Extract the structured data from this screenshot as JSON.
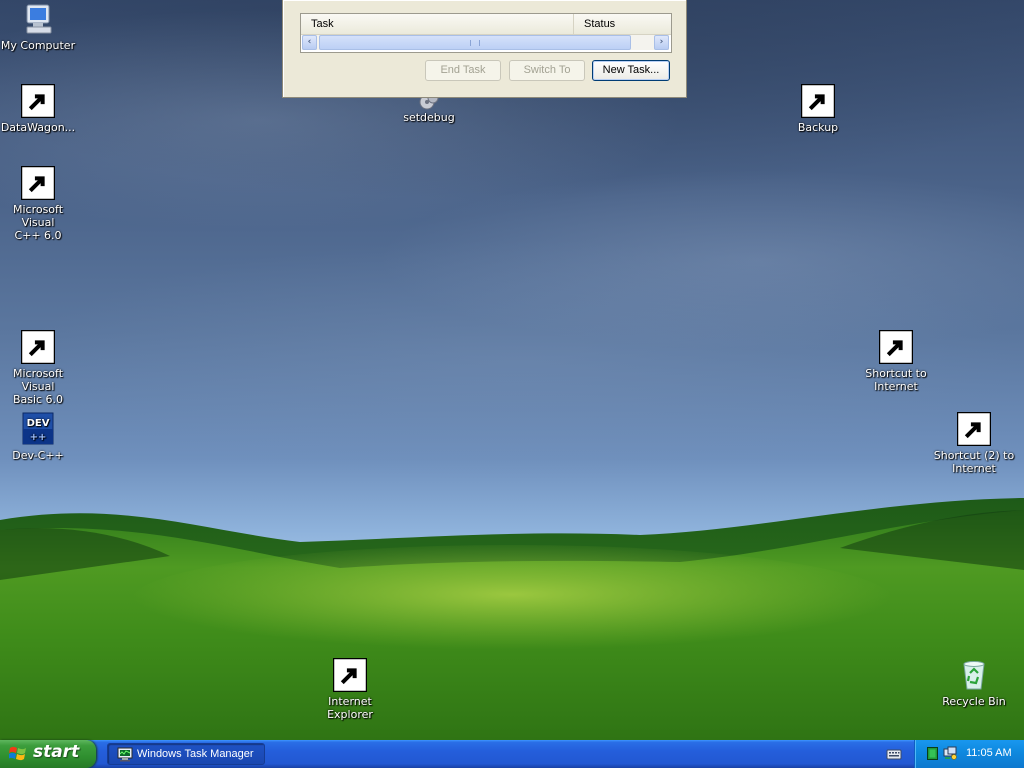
{
  "desktop": {
    "icons": [
      {
        "id": "my-computer",
        "label": "My Computer"
      },
      {
        "id": "datawagon",
        "label": "DataWagon..."
      },
      {
        "id": "setdebug",
        "label": "setdebug"
      },
      {
        "id": "backup",
        "label": "Backup"
      },
      {
        "id": "msvc",
        "label": "Microsoft Visual\nC++ 6.0"
      },
      {
        "id": "msvb",
        "label": "Microsoft Visual\nBasic 6.0"
      },
      {
        "id": "devcpp",
        "label": "Dev-C++"
      },
      {
        "id": "shortcut-internet",
        "label": "Shortcut to\nInternet"
      },
      {
        "id": "shortcut2-internet",
        "label": "Shortcut (2) to\nInternet"
      },
      {
        "id": "internet-explorer",
        "label": "Internet\nExplorer"
      },
      {
        "id": "recycle-bin",
        "label": "Recycle Bin"
      }
    ]
  },
  "task_manager": {
    "columns": {
      "task": "Task",
      "status": "Status"
    },
    "buttons": {
      "end_task": "End Task",
      "switch_to": "Switch To",
      "new_task": "New Task..."
    }
  },
  "taskbar": {
    "start_label": "start",
    "task_button": "Windows Task Manager",
    "clock": "11:05 AM"
  },
  "colors": {
    "taskbar_blue": "#245edb",
    "start_green": "#3c9d3c",
    "tray_blue": "#0f8ae0",
    "dialog_bg": "#ece9d8"
  },
  "icons": {
    "devcpp_glyph": "DEV"
  }
}
